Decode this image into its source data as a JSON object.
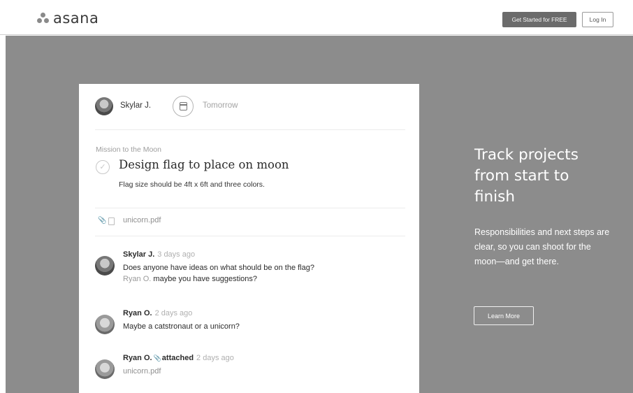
{
  "header": {
    "logo_text": "asana",
    "get_started_label": "Get Started for FREE",
    "login_label": "Log In"
  },
  "task_card": {
    "assignee_name": "Skylar J.",
    "due_date": "Tomorrow",
    "project_name": "Mission to the Moon",
    "task_title": "Design flag to place on moon",
    "task_description": "Flag size should be 4ft x 6ft and three colors.",
    "attachment_name": "unicorn.pdf",
    "check_glyph": "✓",
    "clip_glyph": "📎",
    "comments": [
      {
        "author": "Skylar J.",
        "time": "3 days ago",
        "line1": "Does anyone have ideas on what should be on the flag?",
        "mention": "Ryan O.",
        "line2_rest": " maybe you have suggestions?"
      },
      {
        "author": "Ryan O.",
        "time": "2 days ago",
        "line1": "Maybe a catstronaut or a unicorn?"
      },
      {
        "author": "Ryan O.",
        "action": "attached",
        "time": "2 days ago",
        "file": "unicorn.pdf"
      }
    ]
  },
  "hero_side": {
    "headline": "Track projects from start to finish",
    "body": "Responsibilities and next steps are clear, so you can shoot for the moon—and get there.",
    "learn_more_label": "Learn More"
  },
  "colors": {
    "hero_background": "#8c8c8c",
    "primary_button": "#6b6b6b",
    "card_background": "#ffffff"
  }
}
